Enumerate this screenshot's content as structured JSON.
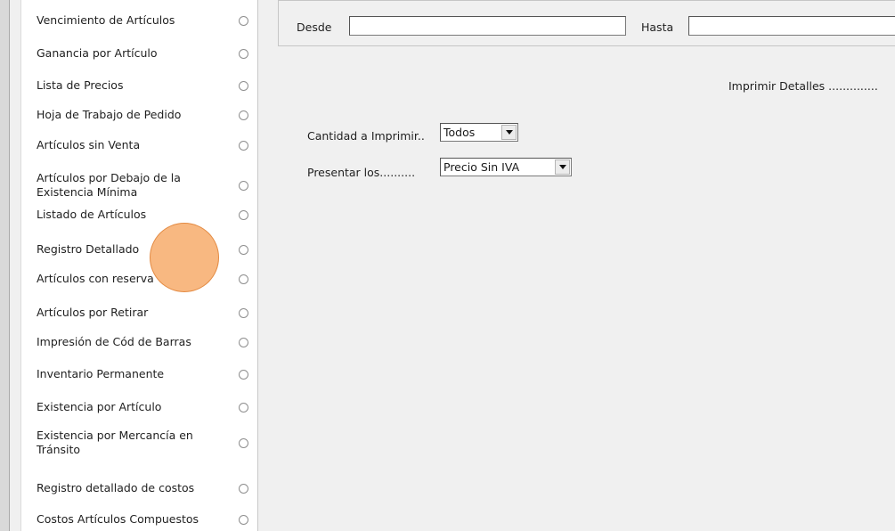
{
  "report_list": {
    "items": [
      {
        "label": "Vencimiento de Artículos"
      },
      {
        "label": "Ganancia por Artículo"
      },
      {
        "label": "Lista de Precios"
      },
      {
        "label": "Hoja de Trabajo de Pedido"
      },
      {
        "label": "Artículos sin Venta"
      },
      {
        "label": "Artículos por Debajo de la Existencia Mínima"
      },
      {
        "label": "Listado de Artículos"
      },
      {
        "label": "Registro Detallado"
      },
      {
        "label": "Artículos con reserva"
      },
      {
        "label": "Artículos por Retirar"
      },
      {
        "label": "Impresión de Cód de Barras"
      },
      {
        "label": "Inventario Permanente"
      },
      {
        "label": "Existencia por Artículo"
      },
      {
        "label": "Existencia por Mercancía en Tránsito"
      },
      {
        "label": "Registro detallado de costos"
      },
      {
        "label": "Costos Artículos Compuestos"
      }
    ]
  },
  "date_range": {
    "from_label": "Desde",
    "from_value": "",
    "to_label": "Hasta",
    "to_value": ""
  },
  "options": {
    "print_details_label": "Imprimir Detalles ..............",
    "quantity_label": "Cantidad a Imprimir..",
    "quantity_value": "Todos",
    "present_label": "Presentar los..........",
    "present_value": "Precio Sin IVA"
  },
  "colors": {
    "background": "#f0f0f0",
    "panel": "#ffffff",
    "cursor_highlight": "#f5964a"
  }
}
